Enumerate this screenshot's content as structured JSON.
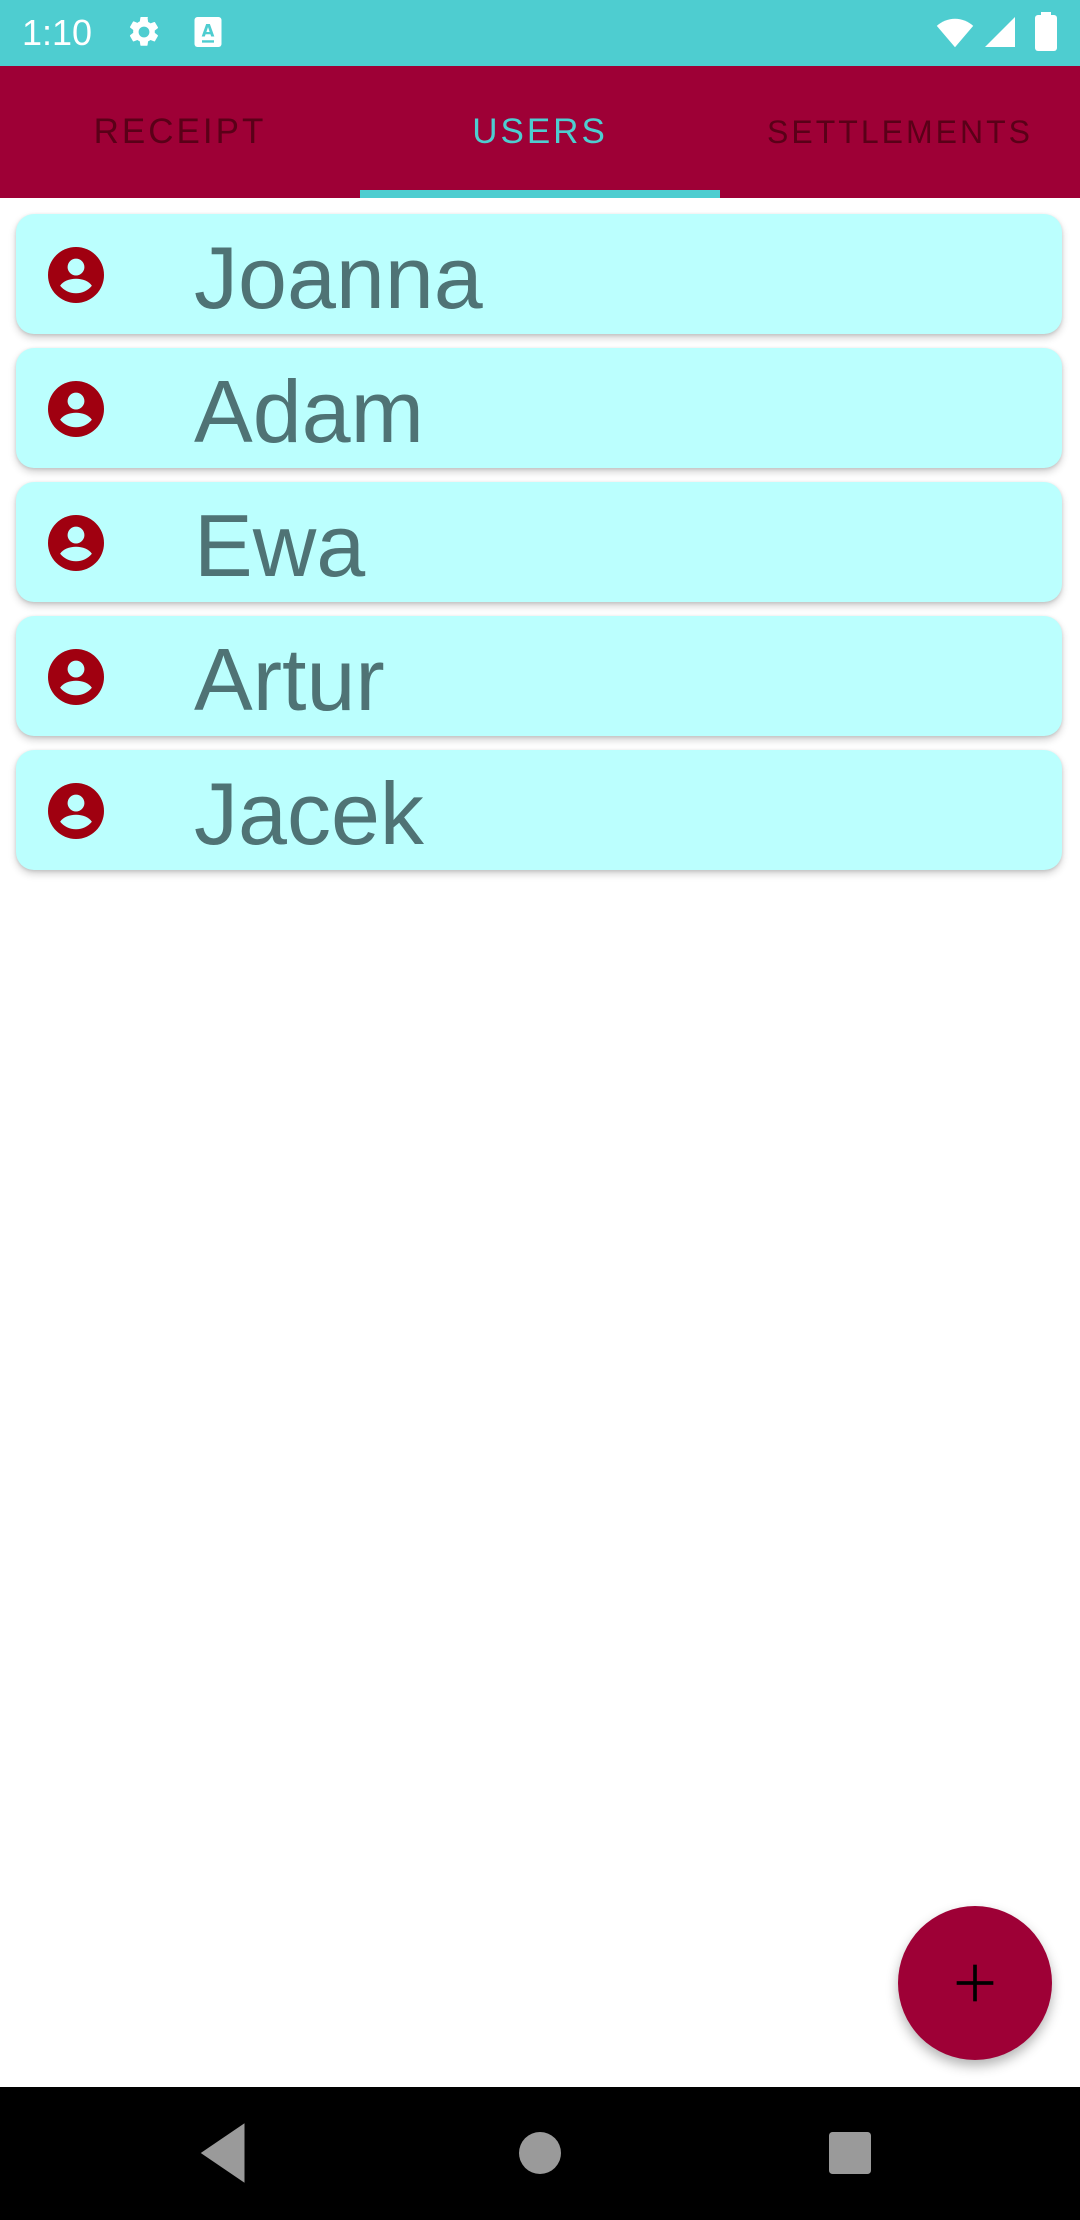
{
  "status_bar": {
    "time": "1:10",
    "icons": [
      "settings-icon",
      "font-a-icon",
      "wifi-icon",
      "signal-icon",
      "battery-icon"
    ],
    "background_color": "#4ecdd0"
  },
  "tabs": [
    {
      "label": "RECEIPT",
      "active": false
    },
    {
      "label": "USERS",
      "active": true
    },
    {
      "label": "SETTLEMENTS",
      "active": false
    }
  ],
  "tab_bar_color": "#9e0036",
  "accent_color": "#4ecdd0",
  "users": [
    {
      "name": "Joanna",
      "icon": "account-circle-icon"
    },
    {
      "name": "Adam",
      "icon": "account-circle-icon"
    },
    {
      "name": "Ewa",
      "icon": "account-circle-icon"
    },
    {
      "name": "Artur",
      "icon": "account-circle-icon"
    },
    {
      "name": "Jacek",
      "icon": "account-circle-icon"
    }
  ],
  "card_color": "#bbfffe",
  "fab": {
    "icon": "plus-icon",
    "color": "#9e0036"
  },
  "nav_bar": {
    "buttons": [
      "back-icon",
      "home-icon",
      "recents-icon"
    ]
  }
}
